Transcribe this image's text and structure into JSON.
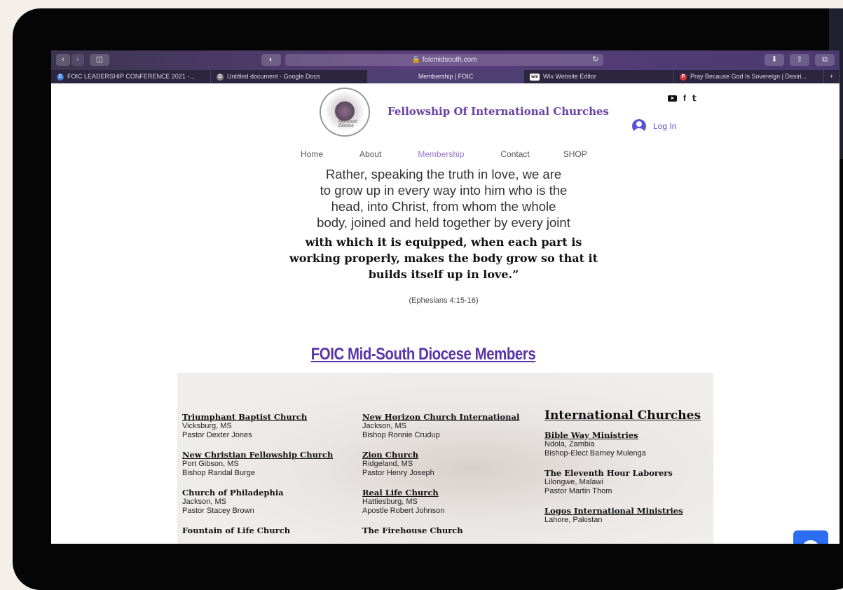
{
  "browser": {
    "url": "foicmidsouth.com",
    "lock_icon": "lock-icon",
    "reload_icon": "↻",
    "tabs": [
      {
        "label": "FOIC LEADERSHIP CONFERENCE 2021 -...",
        "favicon": "C",
        "color": "#3a7bd5",
        "width": 228
      },
      {
        "label": "Untitled document - Google Docs",
        "favicon": "G",
        "color": "#888888",
        "width": 224
      },
      {
        "label": "Membership | FOIC",
        "favicon": "",
        "color": "",
        "width": 223,
        "active": true
      },
      {
        "label": "Wix Website Editor",
        "favicon": "wix",
        "color": "#ffffff",
        "width": 214
      },
      {
        "label": "Pray Because God Is Sovereign | Desiri...",
        "favicon": "P",
        "color": "#d33a3a",
        "width": 214
      }
    ]
  },
  "header": {
    "site_title": "Fellowship Of International Churches",
    "logo_caption": "Mid-South Diocese",
    "login_label": "Log In",
    "social": [
      "youtube-icon",
      "facebook-icon",
      "twitter-icon"
    ]
  },
  "nav": {
    "items": [
      {
        "label": "Home"
      },
      {
        "label": "About"
      },
      {
        "label": "Membership",
        "current": true
      },
      {
        "label": "Contact"
      },
      {
        "label": "SHOP"
      }
    ]
  },
  "quote": {
    "light_lines": [
      "Rather, speaking the truth in love, we are",
      "to grow up in every way into him who is the",
      "head, into Christ, from whom the whole",
      "body, joined and held together by every joint"
    ],
    "bold_lines": [
      "with which it is equipped, when each part is",
      "working properly, makes the body grow so that it",
      "builds itself up in love.”"
    ],
    "citation": "(Ephesians 4:15-16)"
  },
  "members": {
    "title": "FOIC Mid-South Diocese Members",
    "col1": [
      {
        "name": "Triumphant Baptist Church",
        "location": "Vicksburg, MS",
        "leader": "Pastor Dexter Jones",
        "underline": true
      },
      {
        "name": "New Christian Fellowship Church",
        "location": "Port Gibson, MS",
        "leader": "Bishop Randal Burge",
        "underline": true
      },
      {
        "name": "Church of Philadephia",
        "location": "Jackson, MS",
        "leader": "Pastor Stacey Brown",
        "underline": false
      },
      {
        "name": "Fountain of Life Church",
        "location": "",
        "leader": "",
        "underline": false
      }
    ],
    "col2": [
      {
        "name": "New Horizon Church International",
        "location": "Jackson, MS",
        "leader": "Bishop Ronnie Crudup",
        "underline": true
      },
      {
        "name": "Zion Church",
        "location": "Ridgeland, MS",
        "leader": "Pastor Henry Joseph",
        "underline": true
      },
      {
        "name": "Real Life Church",
        "location": "Hattiesburg, MS",
        "leader": "Apostle Robert Johnson",
        "underline": true
      },
      {
        "name": "The Firehouse Church",
        "location": "",
        "leader": "",
        "underline": false
      }
    ],
    "international_title": "International Churches",
    "col3": [
      {
        "name": "Bible Way Ministries",
        "location": "Ndola, Zambia",
        "leader": "Bishop-Elect Barney Mulenga",
        "underline": true
      },
      {
        "name": "The Eleventh Hour Laborers",
        "location": "Lilongwe, Malawi",
        "leader": "Pastor Martin Thom",
        "underline": false
      },
      {
        "name": "Logos International Ministries",
        "location": "Lahore, Pakistan",
        "leader": "",
        "underline": true
      }
    ]
  },
  "chat": {
    "icon": "chat-icon"
  }
}
